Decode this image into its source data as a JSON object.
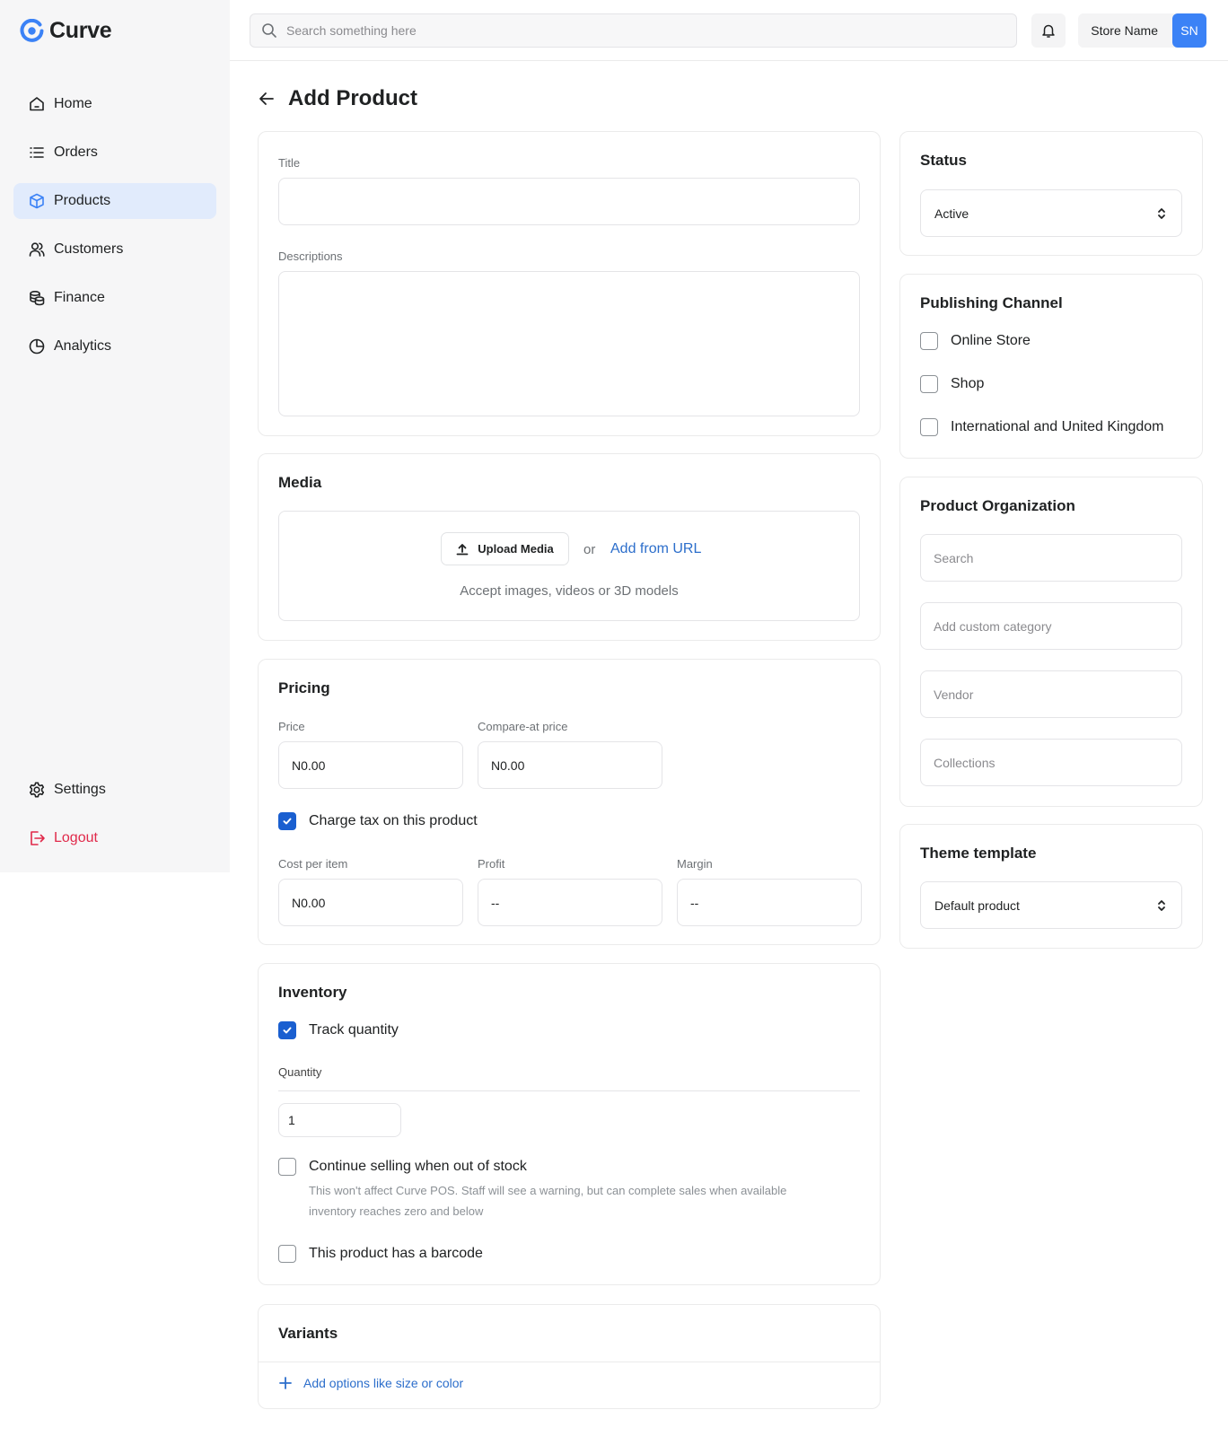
{
  "app": {
    "logo_text": "Curve"
  },
  "sidebar": {
    "items": [
      {
        "label": "Home",
        "icon": "home-icon"
      },
      {
        "label": "Orders",
        "icon": "list-icon"
      },
      {
        "label": "Products",
        "icon": "box-icon",
        "active": true
      },
      {
        "label": "Customers",
        "icon": "users-icon"
      },
      {
        "label": "Finance",
        "icon": "coins-icon"
      },
      {
        "label": "Analytics",
        "icon": "pie-chart-icon"
      }
    ],
    "bottom_items": [
      {
        "label": "Settings",
        "icon": "gear-icon"
      },
      {
        "label": "Logout",
        "icon": "logout-icon"
      }
    ]
  },
  "topbar": {
    "search_placeholder": "Search something here",
    "store_name": "Store Name",
    "avatar_initials": "SN"
  },
  "page": {
    "title": "Add Product"
  },
  "details": {
    "title_label": "Title",
    "title_value": "",
    "descriptions_label": "Descriptions",
    "descriptions_value": ""
  },
  "media": {
    "title": "Media",
    "upload_button": "Upload Media",
    "or_text": "or",
    "add_from_url": "Add from URL",
    "accept_text": "Accept images, videos or 3D models"
  },
  "pricing": {
    "title": "Pricing",
    "price_label": "Price",
    "price_value": "N0.00",
    "compare_label": "Compare-at price",
    "compare_value": "N0.00",
    "charge_tax_label": "Charge tax on this product",
    "charge_tax_checked": true,
    "cost_label": "Cost per item",
    "cost_value": "N0.00",
    "profit_label": "Profit",
    "profit_value": "--",
    "margin_label": "Margin",
    "margin_value": "--"
  },
  "inventory": {
    "title": "Inventory",
    "track_label": "Track quantity",
    "track_checked": true,
    "quantity_label": "Quantity",
    "quantity_value": "1",
    "continue_label": "Continue selling when out of stock",
    "continue_checked": false,
    "continue_hint_line1": "This won't affect Curve POS. Staff will see a warning, but can complete sales when available",
    "continue_hint_line2": "inventory reaches zero and below",
    "barcode_label": "This product has a barcode",
    "barcode_checked": false
  },
  "variants": {
    "title": "Variants",
    "add_options": "Add options like size or color"
  },
  "status": {
    "title": "Status",
    "selected": "Active"
  },
  "publishing": {
    "title": "Publishing Channel",
    "channels": [
      {
        "label": "Online Store",
        "checked": false
      },
      {
        "label": "Shop",
        "checked": false
      },
      {
        "label": "International and United Kingdom",
        "checked": false
      }
    ]
  },
  "organization": {
    "title": "Product Organization",
    "search_placeholder": "Search",
    "category_placeholder": "Add custom category",
    "vendor_placeholder": "Vendor",
    "collections_placeholder": "Collections"
  },
  "theme": {
    "title": "Theme template",
    "selected": "Default product"
  },
  "colors": {
    "accent": "#3b82f6",
    "active_nav_bg": "#e1ebfc",
    "checkbox_checked": "#1a5fd0",
    "link": "#2c6ecb",
    "logout": "#e0294a"
  }
}
